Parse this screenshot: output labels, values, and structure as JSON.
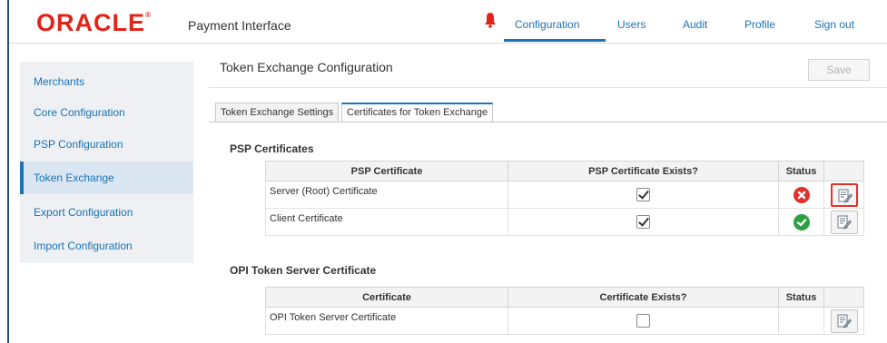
{
  "header": {
    "brand": "ORACLE",
    "brand_mark": "®",
    "app_name": "Payment Interface",
    "nav": [
      {
        "label": "Configuration"
      },
      {
        "label": "Users"
      },
      {
        "label": "Audit"
      },
      {
        "label": "Profile"
      },
      {
        "label": "Sign out"
      }
    ]
  },
  "sidebar": {
    "items": [
      {
        "label": "Merchants"
      },
      {
        "label": "Core Configuration"
      },
      {
        "label": "PSP Configuration"
      },
      {
        "label": "Token Exchange"
      },
      {
        "label": "Export Configuration"
      },
      {
        "label": "Import Configuration"
      }
    ]
  },
  "main": {
    "title": "Token Exchange Configuration",
    "save_label": "Save",
    "tabs": [
      {
        "label": "Token Exchange Settings"
      },
      {
        "label": "Certificates for Token Exchange"
      }
    ],
    "psp_section": {
      "title": "PSP Certificates",
      "columns": [
        "PSP Certificate",
        "PSP Certificate Exists?",
        "Status"
      ],
      "rows": [
        {
          "name": "Server (Root) Certificate",
          "exists": true,
          "status": "error"
        },
        {
          "name": "Client Certificate",
          "exists": true,
          "status": "ok"
        }
      ]
    },
    "opi_section": {
      "title": "OPI Token Server Certificate",
      "columns": [
        "Certificate",
        "Certificate Exists?",
        "Status"
      ],
      "rows": [
        {
          "name": "OPI Token Server Certificate",
          "exists": false,
          "status": "none"
        }
      ]
    }
  },
  "colors": {
    "brand_red": "#e2231a",
    "accent_blue": "#1a73b5",
    "error_red": "#e0322b",
    "ok_green": "#2ea043"
  }
}
